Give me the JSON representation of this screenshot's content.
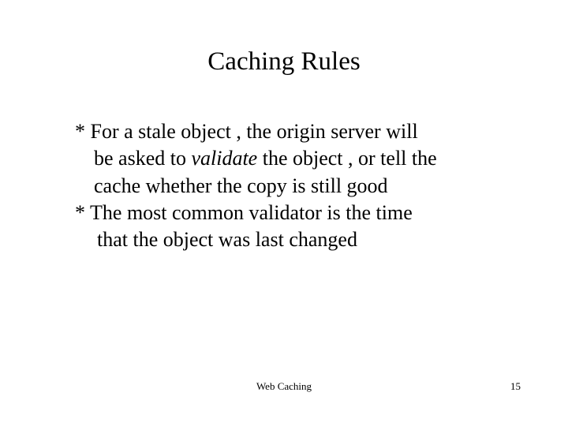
{
  "title": "Caching Rules",
  "body": {
    "line1": "* For a stale object , the origin server will",
    "line2_a": "be asked to ",
    "line2_b": "validate",
    "line2_c": " the object , or tell the",
    "line3": "cache whether the copy is still good",
    "line4": "* The most common validator is the time",
    "line5": "that the object was last changed"
  },
  "footer": "Web  Caching",
  "page_number": "15"
}
